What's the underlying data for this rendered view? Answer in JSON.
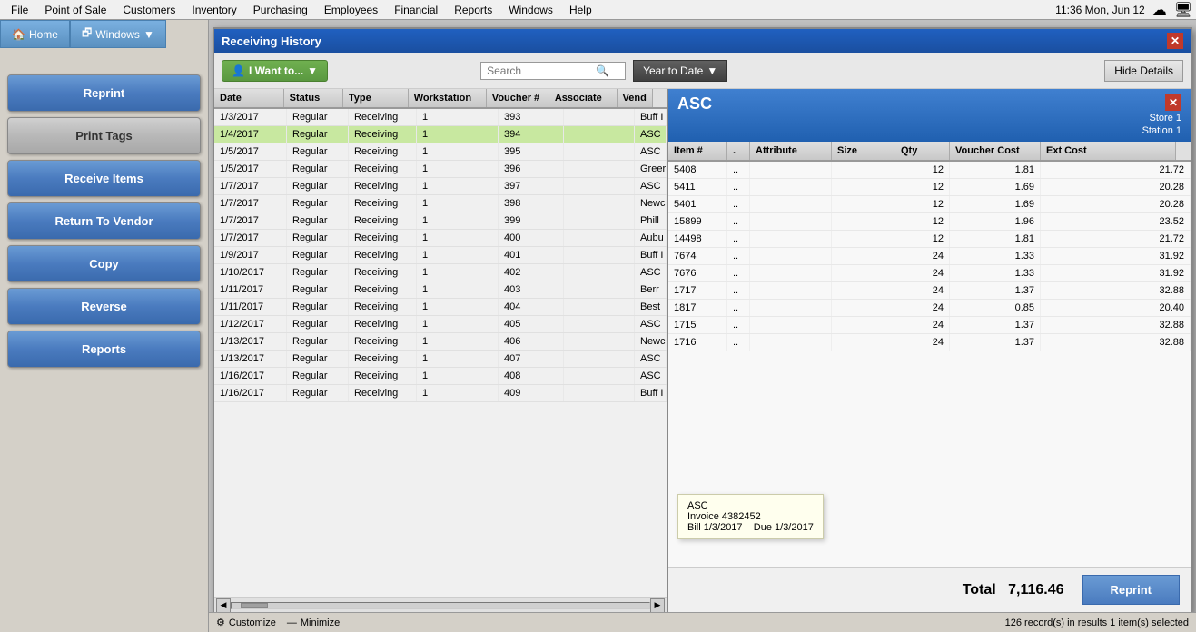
{
  "menubar": {
    "items": [
      "File",
      "Point of Sale",
      "Customers",
      "Inventory",
      "Purchasing",
      "Employees",
      "Financial",
      "Reports",
      "Windows",
      "Help"
    ],
    "time": "11:36 Mon, Jun 12"
  },
  "sidebar": {
    "buttons": [
      {
        "label": "Reprint",
        "style": "blue",
        "name": "reprint-button"
      },
      {
        "label": "Print Tags",
        "style": "gray",
        "name": "print-tags-button"
      },
      {
        "label": "Receive Items",
        "style": "blue",
        "name": "receive-items-button"
      },
      {
        "label": "Return To Vendor",
        "style": "blue",
        "name": "return-to-vendor-button"
      },
      {
        "label": "Copy",
        "style": "blue",
        "name": "copy-button"
      },
      {
        "label": "Reverse",
        "style": "blue",
        "name": "reverse-button"
      },
      {
        "label": "Reports",
        "style": "blue",
        "name": "reports-button"
      }
    ]
  },
  "receiving_window": {
    "title": "Receiving History",
    "toolbar": {
      "iwant_label": "I Want to...",
      "search_placeholder": "Search",
      "date_filter": "Year to Date",
      "hide_details_label": "Hide Details"
    },
    "table": {
      "columns": [
        "Date",
        "Status",
        "Type",
        "Workstation",
        "Voucher #",
        "Associate",
        "Vend"
      ],
      "rows": [
        {
          "date": "1/3/2017",
          "status": "Regular",
          "type": "Receiving",
          "workstation": "1",
          "voucher": "393",
          "associate": "",
          "vendor": "Buff I"
        },
        {
          "date": "1/4/2017",
          "status": "Regular",
          "type": "Receiving",
          "workstation": "1",
          "voucher": "394",
          "associate": "",
          "vendor": "ASC",
          "selected": true,
          "highlighted": true
        },
        {
          "date": "1/5/2017",
          "status": "Regular",
          "type": "Receiving",
          "workstation": "1",
          "voucher": "395",
          "associate": "",
          "vendor": "ASC"
        },
        {
          "date": "1/5/2017",
          "status": "Regular",
          "type": "Receiving",
          "workstation": "1",
          "voucher": "396",
          "associate": "",
          "vendor": "Greer"
        },
        {
          "date": "1/7/2017",
          "status": "Regular",
          "type": "Receiving",
          "workstation": "1",
          "voucher": "397",
          "associate": "",
          "vendor": "ASC"
        },
        {
          "date": "1/7/2017",
          "status": "Regular",
          "type": "Receiving",
          "workstation": "1",
          "voucher": "398",
          "associate": "",
          "vendor": "Newc"
        },
        {
          "date": "1/7/2017",
          "status": "Regular",
          "type": "Receiving",
          "workstation": "1",
          "voucher": "399",
          "associate": "",
          "vendor": "Phill"
        },
        {
          "date": "1/7/2017",
          "status": "Regular",
          "type": "Receiving",
          "workstation": "1",
          "voucher": "400",
          "associate": "",
          "vendor": "Aubu"
        },
        {
          "date": "1/9/2017",
          "status": "Regular",
          "type": "Receiving",
          "workstation": "1",
          "voucher": "401",
          "associate": "",
          "vendor": "Buff I"
        },
        {
          "date": "1/10/2017",
          "status": "Regular",
          "type": "Receiving",
          "workstation": "1",
          "voucher": "402",
          "associate": "",
          "vendor": "ASC"
        },
        {
          "date": "1/11/2017",
          "status": "Regular",
          "type": "Receiving",
          "workstation": "1",
          "voucher": "403",
          "associate": "",
          "vendor": "Berr"
        },
        {
          "date": "1/11/2017",
          "status": "Regular",
          "type": "Receiving",
          "workstation": "1",
          "voucher": "404",
          "associate": "",
          "vendor": "Best"
        },
        {
          "date": "1/12/2017",
          "status": "Regular",
          "type": "Receiving",
          "workstation": "1",
          "voucher": "405",
          "associate": "",
          "vendor": "ASC"
        },
        {
          "date": "1/13/2017",
          "status": "Regular",
          "type": "Receiving",
          "workstation": "1",
          "voucher": "406",
          "associate": "",
          "vendor": "Newc"
        },
        {
          "date": "1/13/2017",
          "status": "Regular",
          "type": "Receiving",
          "workstation": "1",
          "voucher": "407",
          "associate": "",
          "vendor": "ASC"
        },
        {
          "date": "1/16/2017",
          "status": "Regular",
          "type": "Receiving",
          "workstation": "1",
          "voucher": "408",
          "associate": "",
          "vendor": "ASC"
        },
        {
          "date": "1/16/2017",
          "status": "Regular",
          "type": "Receiving",
          "workstation": "1",
          "voucher": "409",
          "associate": "",
          "vendor": "Buff I"
        }
      ]
    },
    "status_bar": "126 record(s) in results  1 item(s) selected"
  },
  "detail_panel": {
    "vendor_name": "ASC",
    "store": "Store 1",
    "station": "Station 1",
    "columns": [
      "Item #",
      ".",
      "Attribute",
      "Size",
      "Qty",
      "Voucher Cost",
      "Ext Cost"
    ],
    "rows": [
      {
        "item": "5408",
        "dot": "..",
        "attr": "",
        "size": "",
        "qty": "12",
        "vcost": "1.81",
        "ecost": "21.72"
      },
      {
        "item": "5411",
        "dot": "..",
        "attr": "",
        "size": "",
        "qty": "12",
        "vcost": "1.69",
        "ecost": "20.28"
      },
      {
        "item": "5401",
        "dot": "..",
        "attr": "",
        "size": "",
        "qty": "12",
        "vcost": "1.69",
        "ecost": "20.28"
      },
      {
        "item": "15899",
        "dot": "..",
        "attr": "",
        "size": "",
        "qty": "12",
        "vcost": "1.96",
        "ecost": "23.52"
      },
      {
        "item": "14498",
        "dot": "..",
        "attr": "",
        "size": "",
        "qty": "12",
        "vcost": "1.81",
        "ecost": "21.72"
      },
      {
        "item": "7674",
        "dot": "..",
        "attr": "",
        "size": "",
        "qty": "24",
        "vcost": "1.33",
        "ecost": "31.92"
      },
      {
        "item": "7676",
        "dot": "..",
        "attr": "",
        "size": "",
        "qty": "24",
        "vcost": "1.33",
        "ecost": "31.92"
      },
      {
        "item": "1717",
        "dot": "..",
        "attr": "",
        "size": "",
        "qty": "24",
        "vcost": "1.37",
        "ecost": "32.88"
      },
      {
        "item": "1817",
        "dot": "..",
        "attr": "",
        "size": "",
        "qty": "24",
        "vcost": "0.85",
        "ecost": "20.40"
      },
      {
        "item": "1715",
        "dot": "..",
        "attr": "",
        "size": "",
        "qty": "24",
        "vcost": "1.37",
        "ecost": "32.88"
      },
      {
        "item": "1716",
        "dot": "..",
        "attr": "",
        "size": "",
        "qty": "24",
        "vcost": "1.37",
        "ecost": "32.88"
      }
    ],
    "tooltip": {
      "vendor": "ASC",
      "invoice": "Invoice 4382452",
      "bill_date": "Bill 1/3/2017",
      "due_date": "Due 1/3/2017"
    },
    "total_label": "Total",
    "total_value": "7,116.46",
    "reprint_label": "Reprint"
  },
  "statusbar": {
    "customize_label": "Customize",
    "minimize_label": "Minimize"
  }
}
